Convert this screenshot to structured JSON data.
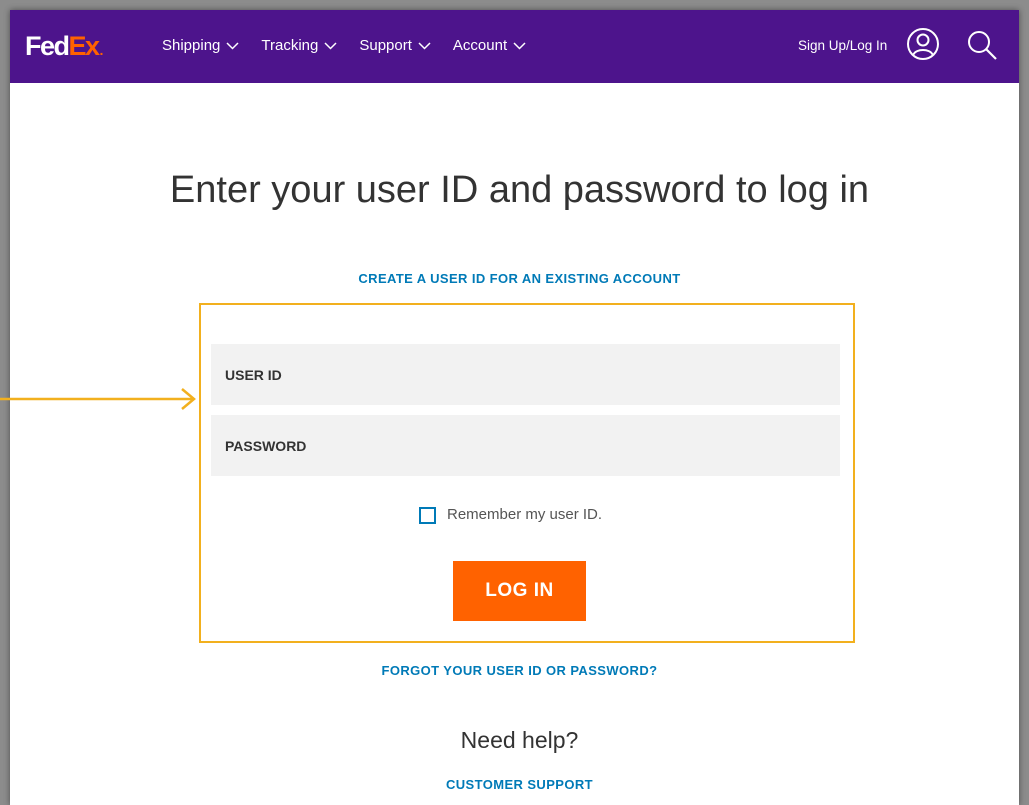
{
  "header": {
    "logo": {
      "fed": "Fed",
      "ex": "Ex",
      "dot": "."
    },
    "nav": [
      {
        "label": "Shipping"
      },
      {
        "label": "Tracking"
      },
      {
        "label": "Support"
      },
      {
        "label": "Account"
      }
    ],
    "login_link": "Sign Up/Log In",
    "icons": {
      "user": "user-circle-icon",
      "search": "search-icon",
      "chevron": "chevron-down-icon"
    }
  },
  "main": {
    "title": "Enter your user ID and password to log in",
    "create_link": "CREATE A USER ID FOR AN EXISTING ACCOUNT",
    "form": {
      "userid_placeholder": "USER ID",
      "password_placeholder": "PASSWORD",
      "remember_label": "Remember my user ID.",
      "login_button": "LOG IN"
    },
    "forgot_link": "FORGOT YOUR USER ID OR PASSWORD?",
    "help_heading": "Need help?",
    "support_link": "CUSTOMER SUPPORT"
  },
  "colors": {
    "brand_purple": "#4d148c",
    "brand_orange": "#ff6200",
    "link_blue": "#007ab7",
    "highlight_yellow": "#f2b01e"
  }
}
